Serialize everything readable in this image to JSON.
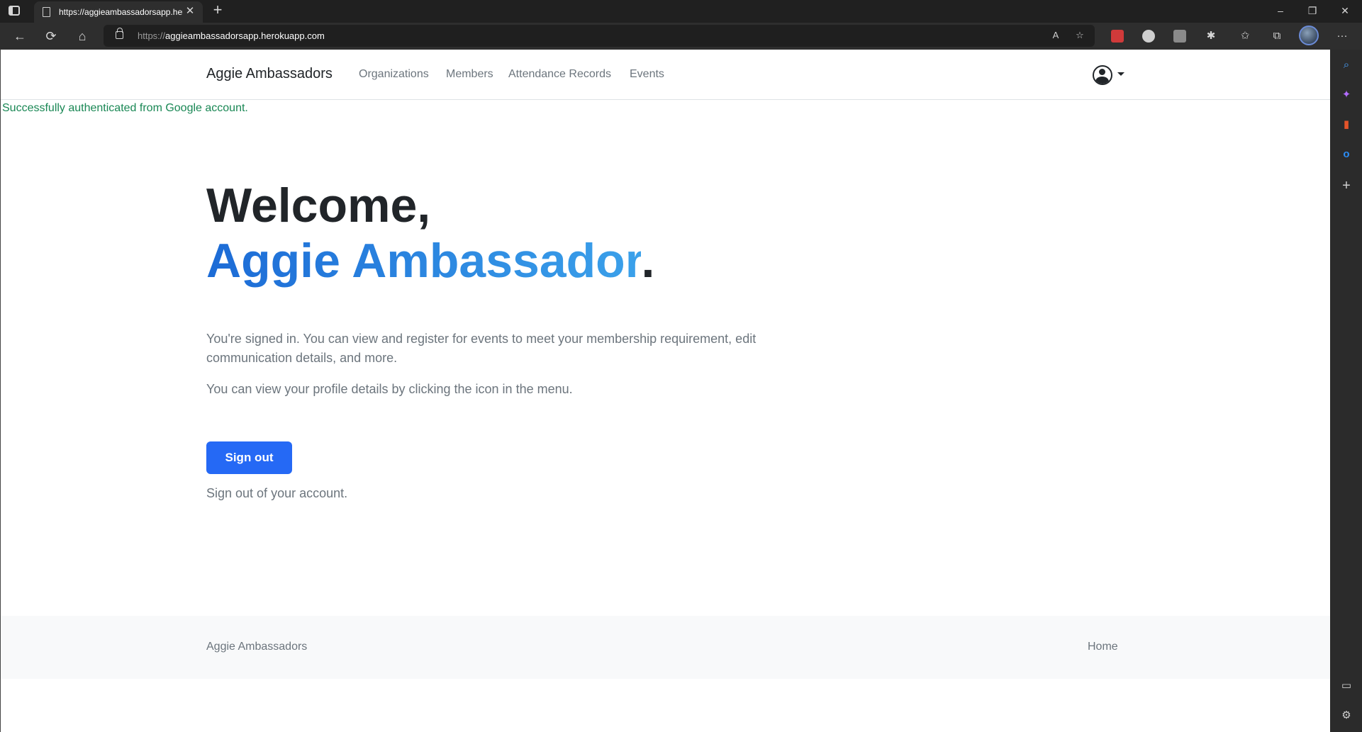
{
  "browser": {
    "tab_title": "https://aggieambassadorsapp.herokuapp.com",
    "url_protocol": "https://",
    "url_host": "aggieambassadorsapp.herokuapp.com",
    "icons": {
      "tab_actions": "tab-actions-icon",
      "new_tab": "+",
      "close_tab": "✕",
      "minimize": "–",
      "restore": "❐",
      "close_window": "✕",
      "back": "←",
      "refresh": "⟳",
      "home": "⌂",
      "read_aloud": "A",
      "favorite": "☆",
      "favorites": "✩",
      "collections": "⧉",
      "more": "···",
      "extensions": "✱"
    }
  },
  "sidebar": {
    "icons": [
      "search-icon",
      "copilot-icon",
      "office-icon",
      "outlook-icon",
      "add-icon"
    ],
    "glyphs": {
      "search": "⌕",
      "copilot": "✦",
      "office": "▮",
      "outlook": "o",
      "add": "+",
      "panel": "▭",
      "settings": "⚙"
    }
  },
  "navbar": {
    "brand": "Aggie Ambassadors",
    "links": [
      "Organizations",
      "Members",
      "Attendance Records",
      "Events"
    ]
  },
  "flash": "Successfully authenticated from Google account.",
  "hero": {
    "line1": "Welcome,",
    "name": "Aggie Ambassador",
    "period": "."
  },
  "body": {
    "para1": "You're signed in. You can view and register for events to meet your membership requirement, edit communication details, and more.",
    "para2": "You can view your profile details by clicking the icon in the menu.",
    "signout_label": "Sign out",
    "signout_sub": "Sign out of your account."
  },
  "footer": {
    "brand": "Aggie Ambassadors",
    "home": "Home"
  },
  "colors": {
    "accent": "#2569f5",
    "success": "#198754",
    "gradient_start": "#1c6bd6",
    "gradient_end": "#3ba1ea"
  }
}
